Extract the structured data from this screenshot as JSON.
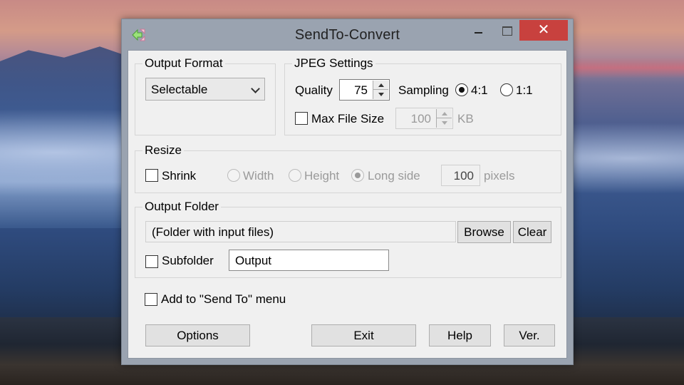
{
  "window": {
    "title": "SendTo-Convert",
    "close_glyph": "✕"
  },
  "output_format": {
    "label": "Output Format",
    "selected": "Selectable"
  },
  "jpeg_settings": {
    "label": "JPEG Settings",
    "quality_label": "Quality",
    "quality_value": "75",
    "sampling_label": "Sampling",
    "sampling_options": [
      "4:1",
      "1:1"
    ],
    "sampling_selected": "4:1",
    "max_file_size_label": "Max File Size",
    "max_file_size_value": "100",
    "max_file_size_unit": "KB"
  },
  "resize": {
    "label": "Resize",
    "shrink_label": "Shrink",
    "options": [
      "Width",
      "Height",
      "Long side"
    ],
    "selected": "Long side",
    "value": "100",
    "unit": "pixels"
  },
  "output_folder": {
    "label": "Output Folder",
    "path": "(Folder with input files)",
    "browse_label": "Browse",
    "clear_label": "Clear",
    "subfolder_label": "Subfolder",
    "subfolder_value": "Output"
  },
  "send_to": {
    "label": "Add to \"Send To\" menu"
  },
  "buttons": {
    "options": "Options",
    "exit": "Exit",
    "help": "Help",
    "version": "Ver."
  }
}
